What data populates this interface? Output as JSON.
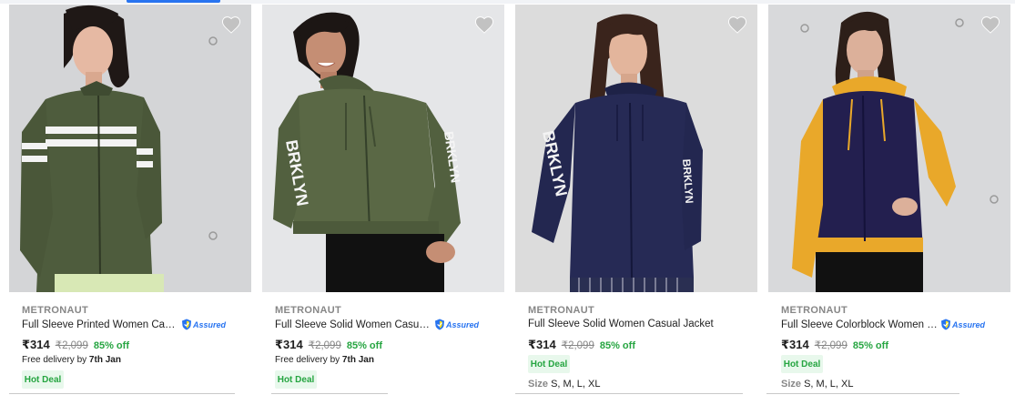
{
  "colors": {
    "accent": "#2874f0",
    "discount": "#26a541",
    "muted": "#878787",
    "deal_bg": "#e8f8ec"
  },
  "products": [
    {
      "brand": "METRONAUT",
      "title": "Full Sleeve Printed Women Casual Jacket",
      "assured_label": "Assured",
      "price": "₹314",
      "mrp": "₹2,099",
      "discount": "85% off",
      "delivery_prefix": "Free delivery by",
      "delivery_date": "7th Jan",
      "deal_label": "Hot Deal",
      "sizes_label": "",
      "sizes_values": "",
      "image": "woman-olive-stripe-zip-jacket",
      "jacket_color": "#4e5c3d",
      "sleeve_color": "#4e5c3d"
    },
    {
      "brand": "METRONAUT",
      "title": "Full Sleeve Solid Women Casual Jacket",
      "assured_label": "Assured",
      "price": "₹314",
      "mrp": "₹2,099",
      "discount": "85% off",
      "delivery_prefix": "Free delivery by",
      "delivery_date": "7th Jan",
      "deal_label": "Hot Deal",
      "sizes_label": "",
      "sizes_values": "",
      "image": "woman-olive-hoodie-brklyn",
      "jacket_color": "#5a6845",
      "sleeve_color": "#5a6845",
      "sleeve_text": "BRKLYN"
    },
    {
      "brand": "METRONAUT",
      "title": "Full Sleeve Solid Women Casual Jacket",
      "assured_label": "",
      "price": "₹314",
      "mrp": "₹2,099",
      "discount": "85% off",
      "delivery_prefix": "",
      "delivery_date": "",
      "deal_label": "Hot Deal",
      "sizes_label": "Size",
      "sizes_values": "S, M, L, XL",
      "image": "woman-navy-hoodie-brklyn",
      "jacket_color": "#262a55",
      "sleeve_color": "#262a55",
      "sleeve_text": "BRKLYN"
    },
    {
      "brand": "METRONAUT",
      "title": "Full Sleeve Colorblock Women Casual Jacket",
      "assured_label": "Assured",
      "price": "₹314",
      "mrp": "₹2,099",
      "discount": "85% off",
      "delivery_prefix": "",
      "delivery_date": "",
      "deal_label": "Hot Deal",
      "sizes_label": "Size",
      "sizes_values": "S, M, L, XL",
      "image": "woman-navy-mustard-colorblock-hoodie",
      "jacket_color": "#231f4f",
      "sleeve_color": "#e9a82a"
    }
  ]
}
